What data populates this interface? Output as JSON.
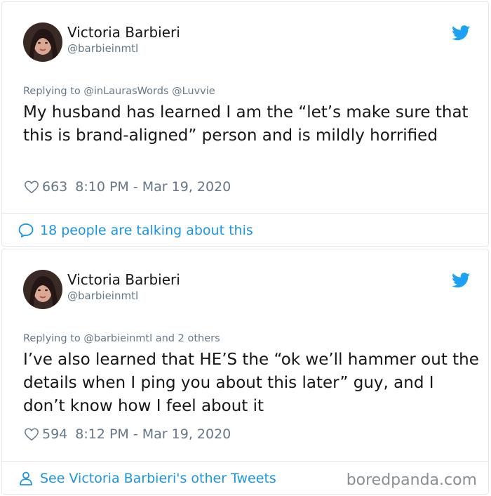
{
  "colors": {
    "link": "#1b95e0",
    "muted": "#657786",
    "text": "#14171a",
    "border": "#e1e8ed"
  },
  "tweets": [
    {
      "author": {
        "name": "Victoria Barbieri",
        "handle": "@barbieinmtl"
      },
      "reply_prefix": "Replying to",
      "reply_targets": "@inLaurasWords @Luvvie",
      "text": "My husband has learned I am the “let’s make sure that this is brand-aligned” person and is mildly horrified",
      "likes": "663",
      "timestamp": "8:10 PM - Mar 19, 2020",
      "footer_text": "18 people are talking about this",
      "footer_icon": "speech-bubble-icon"
    },
    {
      "author": {
        "name": "Victoria Barbieri",
        "handle": "@barbieinmtl"
      },
      "reply_prefix": "Replying to",
      "reply_targets": "@barbieinmtl and 2 others",
      "text": "I’ve also learned that HE’S the “ok we’ll hammer out the details when I ping you about this later” guy, and I don’t know how I feel about it",
      "likes": "594",
      "timestamp": "8:12 PM - Mar 19, 2020",
      "footer_text": "See Victoria Barbieri's other Tweets",
      "footer_icon": "person-icon"
    }
  ],
  "watermark": "boredpanda.com"
}
